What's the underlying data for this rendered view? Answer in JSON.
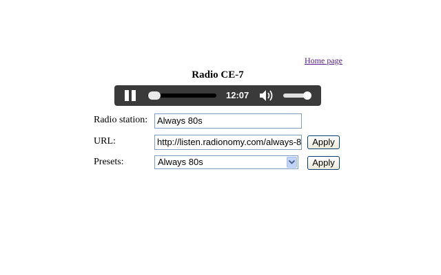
{
  "header": {
    "home_link": "Home page",
    "title": "Radio CE-7"
  },
  "player": {
    "state": "playing",
    "time": "12:07",
    "seek_progress": 0.05,
    "volume": 0.95,
    "colors": {
      "bar": "#3a3a3a",
      "track": "#000000",
      "knob": "#e9e9e9"
    },
    "icons": {
      "play_pause": "pause-icon",
      "volume": "speaker-icon"
    }
  },
  "form": {
    "station": {
      "label": "Radio station:",
      "value": "Always 80s"
    },
    "url": {
      "label": "URL:",
      "value": "http://listen.radionomy.com/always-8",
      "apply_label": "Apply"
    },
    "presets": {
      "label": "Presets:",
      "selected": "Always 80s",
      "apply_label": "Apply"
    }
  }
}
